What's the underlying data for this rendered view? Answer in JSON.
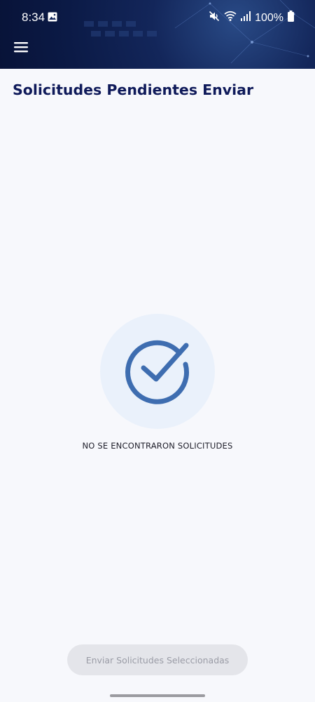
{
  "status_bar": {
    "time": "8:34",
    "battery": "100%",
    "icons": [
      "gallery-icon",
      "mute-icon",
      "wifi-icon",
      "signal-icon",
      "battery-icon"
    ]
  },
  "header": {
    "menu_icon": "hamburger-menu-icon"
  },
  "page": {
    "title": "Solicitudes Pendientes Enviar"
  },
  "empty_state": {
    "icon": "check-circle-icon",
    "message": "NO SE ENCONTRARON SOLICITUDES"
  },
  "footer": {
    "send_button_label": "Enviar Solicitudes Seleccionadas",
    "send_button_enabled": false
  },
  "colors": {
    "header_bg": "#0b1a46",
    "title": "#0f1a5a",
    "accent": "#3e6db0",
    "circle_bg": "#eaf1fb",
    "button_bg": "#e4e5ea",
    "button_text": "#9a9ca6"
  }
}
